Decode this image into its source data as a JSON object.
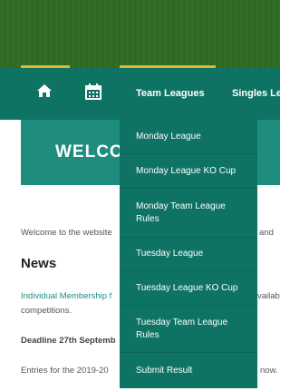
{
  "nav": {
    "home_icon": "home-icon",
    "calendar_icon": "calendar-icon",
    "team_leagues_label": "Team Leagues",
    "singles_label": "Singles Lea"
  },
  "dropdown": {
    "items": [
      {
        "label": "Monday League"
      },
      {
        "label": "Monday League KO Cup"
      },
      {
        "label": "Monday Team League Rules"
      },
      {
        "label": "Tuesday League"
      },
      {
        "label": "Tuesday League KO Cup"
      },
      {
        "label": "Tuesday Team League Rules"
      },
      {
        "label": "Submit Result"
      }
    ]
  },
  "welcome": {
    "title": "WELCO"
  },
  "content": {
    "intro_left": "Welcome to the website",
    "intro_right": "and",
    "news_heading": "News",
    "membership_left": "Individual Membership f",
    "membership_right": "vailab",
    "competitions": "competitions.",
    "deadline": "Deadline 27th Septemb",
    "entries_left": "Entries for the 2019-20",
    "entries_right": "now."
  },
  "colors": {
    "banner_green": "#2f6a22",
    "nav_teal": "#0f7363",
    "welcome_teal": "#1e8d7d",
    "accent_gold": "#e3b62f"
  }
}
